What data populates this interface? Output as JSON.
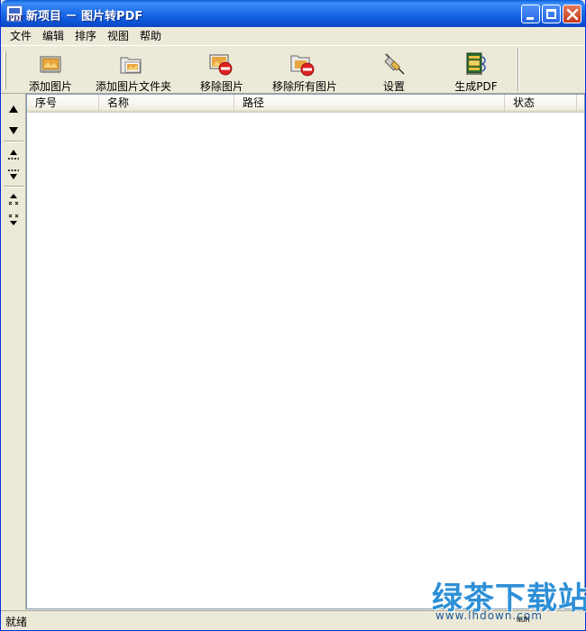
{
  "window": {
    "title": "新项目 － 图片转PDF",
    "app_icon_text": "PDF"
  },
  "menu": {
    "items": [
      "文件",
      "编辑",
      "排序",
      "视图",
      "帮助"
    ]
  },
  "toolbar": {
    "buttons": [
      {
        "label": "添加图片",
        "icon": "add-image-icon"
      },
      {
        "label": "添加图片文件夹",
        "icon": "add-folder-icon"
      },
      {
        "label": "移除图片",
        "icon": "remove-image-icon"
      },
      {
        "label": "移除所有图片",
        "icon": "remove-all-icon"
      },
      {
        "label": "设置",
        "icon": "settings-icon"
      },
      {
        "label": "生成PDF",
        "icon": "generate-pdf-icon"
      }
    ]
  },
  "sidebar": {
    "buttons": [
      "move-up-icon",
      "move-down-icon",
      "move-top-icon",
      "move-bottom-icon",
      "collapse-up-icon",
      "collapse-down-icon"
    ]
  },
  "list": {
    "columns": [
      "序号",
      "名称",
      "路径",
      "状态"
    ],
    "rows": []
  },
  "statusbar": {
    "text": "就绪",
    "indicator": "NUM"
  },
  "watermark": {
    "text": "绿茶下载站",
    "url": "www.lhdown.com"
  },
  "colors": {
    "titlebar": "#0A5FD8",
    "face": "#ECE9D8",
    "close": "#C5391A"
  }
}
